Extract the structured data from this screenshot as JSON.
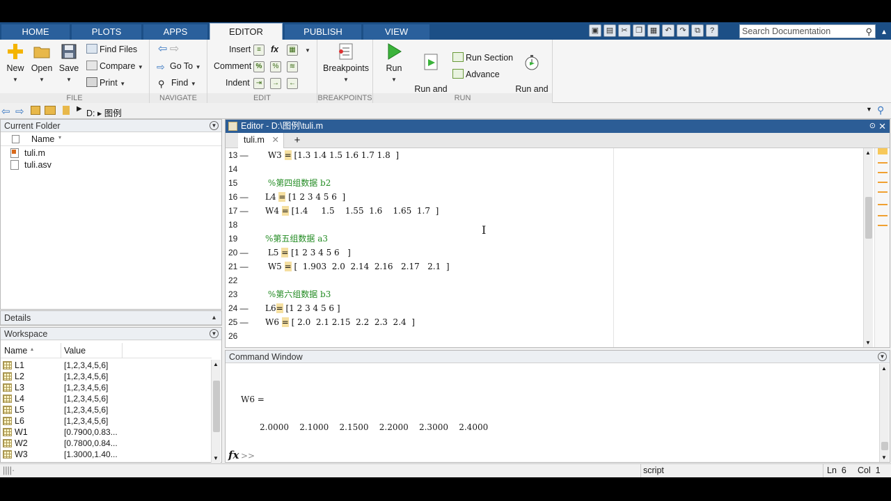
{
  "tabs": [
    "HOME",
    "PLOTS",
    "APPS",
    "EDITOR",
    "PUBLISH",
    "VIEW"
  ],
  "search": {
    "placeholder": "Search Documentation"
  },
  "ribbon": {
    "file": {
      "label": "FILE",
      "new": "New",
      "open": "Open",
      "save": "Save",
      "find_files": "Find Files",
      "compare": "Compare",
      "print": "Print"
    },
    "navigate": {
      "label": "NAVIGATE",
      "go_to": "Go To",
      "find": "Find"
    },
    "edit": {
      "label": "EDIT",
      "insert": "Insert",
      "comment": "Comment",
      "indent": "Indent",
      "fx": "fx"
    },
    "breakpoints": {
      "label": "BREAKPOINTS",
      "breakpoints": "Breakpoints"
    },
    "run": {
      "label": "RUN",
      "run": "Run",
      "run_and_advance": "Run and\nAdvance",
      "run_section": "Run Section",
      "advance": "Advance",
      "run_and_time": "Run and\nTime"
    }
  },
  "address": {
    "path": "D: ▸ 图例",
    "drive": "D:",
    "folder": "图例"
  },
  "current_folder": {
    "title": "Current Folder",
    "column_name": "Name",
    "files": [
      "tuli.m",
      "tuli.asv"
    ]
  },
  "details": {
    "title": "Details"
  },
  "workspace": {
    "title": "Workspace",
    "col_name": "Name",
    "col_value": "Value",
    "rows": [
      {
        "name": "L1",
        "value": "[1,2,3,4,5,6]"
      },
      {
        "name": "L2",
        "value": "[1,2,3,4,5,6]"
      },
      {
        "name": "L3",
        "value": "[1,2,3,4,5,6]"
      },
      {
        "name": "L4",
        "value": "[1,2,3,4,5,6]"
      },
      {
        "name": "L5",
        "value": "[1,2,3,4,5,6]"
      },
      {
        "name": "L6",
        "value": "[1,2,3,4,5,6]"
      },
      {
        "name": "W1",
        "value": "[0.7900,0.83..."
      },
      {
        "name": "W2",
        "value": "[0.7800,0.84..."
      },
      {
        "name": "W3",
        "value": "[1.3000,1.40..."
      }
    ]
  },
  "editor": {
    "title": "Editor - D:\\图例\\tuli.m",
    "tab": "tuli.m",
    "lines": [
      {
        "num": "13",
        "dash": true,
        "text": " W3 = [1.3 1.4 1.5 1.6 1.7 1.8  ]",
        "comment": false
      },
      {
        "num": "14",
        "dash": false,
        "text": "",
        "comment": false
      },
      {
        "num": "15",
        "dash": false,
        "text": " %第四组数据 b2",
        "comment": true
      },
      {
        "num": "16",
        "dash": true,
        "text": "L4 = [1 2 3 4 5 6  ]",
        "comment": false
      },
      {
        "num": "17",
        "dash": true,
        "text": "W4 = [1.4     1.5    1.55  1.6    1.65  1.7  ]",
        "comment": false
      },
      {
        "num": "18",
        "dash": false,
        "text": "",
        "comment": false
      },
      {
        "num": "19",
        "dash": false,
        "text": "%第五组数据 a3",
        "comment": true
      },
      {
        "num": "20",
        "dash": true,
        "text": " L5 = [1 2 3 4 5 6   ]",
        "comment": false
      },
      {
        "num": "21",
        "dash": true,
        "text": " W5 = [  1.903  2.0  2.14  2.16   2.17   2.1  ]",
        "comment": false
      },
      {
        "num": "22",
        "dash": false,
        "text": "",
        "comment": false
      },
      {
        "num": "23",
        "dash": false,
        "text": " %第六组数据 b3",
        "comment": true
      },
      {
        "num": "24",
        "dash": true,
        "text": "L6= [1 2 3 4 5 6 ]",
        "comment": false
      },
      {
        "num": "25",
        "dash": true,
        "text": "W6 = [ 2.0  2.1 2.15  2.2  2.3  2.4  ]",
        "comment": false
      },
      {
        "num": "26",
        "dash": false,
        "text": "",
        "comment": false
      }
    ]
  },
  "command_window": {
    "title": "Command Window",
    "var_line": "W6 =",
    "values_line": "2.0000    2.1000    2.1500    2.2000    2.3000    2.4000",
    "prompt": ">>",
    "fx": "fx"
  },
  "status": {
    "mode": "script",
    "ln": "Ln  6",
    "col": "Col  1"
  }
}
